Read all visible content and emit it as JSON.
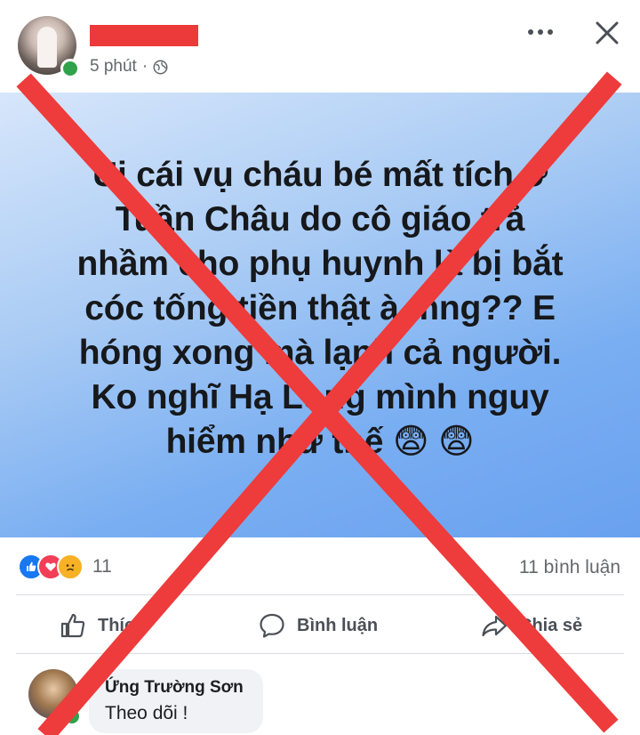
{
  "post": {
    "time": "5 phút",
    "time_separator": "·",
    "privacy_icon": "globe-icon",
    "text": "Ui cái vụ cháu bé mất tích ở\nTuần Châu do cô giáo trả\nnhầm cho phụ huynh là bị bắt\ncóc tống tiền thật à mng?? E\nhóng xong mà lạnh cả người.\nKo nghĩ Hạ Long mình nguy\nhiểm như thế 😨 😨",
    "background_gradient": [
      "#d7e6fb",
      "#6aa1ef"
    ]
  },
  "reactions": {
    "icons": [
      "like-icon",
      "love-icon",
      "sad-icon"
    ],
    "count": "11",
    "comment_count": "11 bình luận"
  },
  "actions": {
    "like": "Thích",
    "comment": "Bình luận",
    "share": "Chia sẻ"
  },
  "comment": {
    "author": "Ứng Trường Sơn",
    "text": "Theo dõi !"
  },
  "colors": {
    "cross_red": "#ee3b3b",
    "online_green": "#31a24c",
    "like_blue": "#1877f2"
  }
}
